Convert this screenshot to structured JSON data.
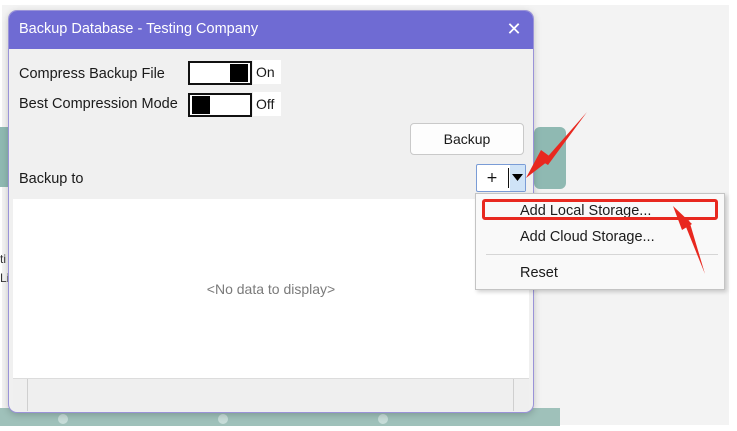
{
  "background": {
    "clip_left_text_1": "ti",
    "clip_left_text_2": "Li"
  },
  "dialog": {
    "title": "Backup Database - Testing Company",
    "close_glyph": "✕",
    "compress": {
      "label": "Compress Backup File",
      "state": "On",
      "on": true
    },
    "best_compression": {
      "label": "Best Compression Mode",
      "state": "Off",
      "on": false
    },
    "backup_button": "Backup",
    "backup_to_label": "Backup to",
    "add_button": "+",
    "empty_message": "<No data to display>"
  },
  "menu": {
    "items": [
      {
        "label": "Add Local Storage...",
        "highlighted": true
      },
      {
        "label": "Add Cloud Storage...",
        "highlighted": false
      },
      {
        "label": "Reset",
        "highlighted": false
      }
    ]
  },
  "colors": {
    "title_bar": "#6f6bd3",
    "annotation": "#e8281f",
    "dropdown_arrow_bg": "#cfe3f7"
  },
  "icons": {
    "close": "close-icon",
    "dropdown": "chevron-down-icon",
    "annotation": "red-arrow-icon"
  }
}
